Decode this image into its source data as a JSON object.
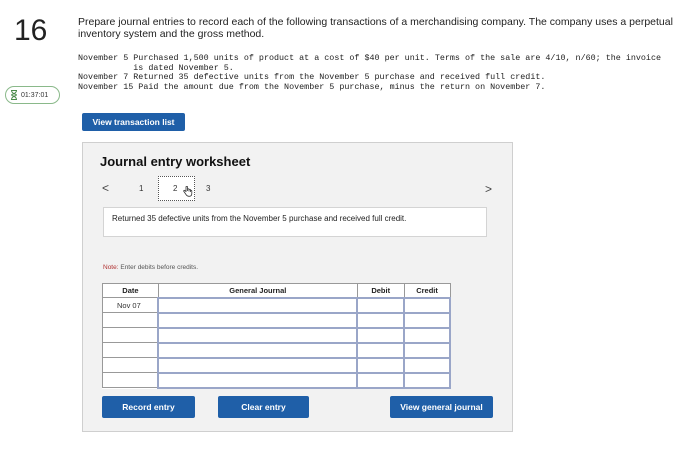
{
  "question": {
    "number": "16"
  },
  "timer": {
    "value": "01:37:01"
  },
  "prompt": "Prepare journal entries to record each of the following transactions of a merchandising company. The company uses a perpetual inventory system and the gross method.",
  "transactions": [
    "November 5 Purchased 1,500 units of product at a cost of $40 per unit. Terms of the sale are 4/10, n/60; the invoice",
    "           is dated November 5.",
    "November 7 Returned 35 defective units from the November 5 purchase and received full credit.",
    "November 15 Paid the amount due from the November 5 purchase, minus the return on November 7."
  ],
  "buttons": {
    "view_transaction_list": "View transaction list",
    "record_entry": "Record entry",
    "clear_entry": "Clear entry",
    "view_general_journal": "View general journal"
  },
  "worksheet": {
    "title": "Journal entry worksheet",
    "pages": [
      "1",
      "2",
      "3"
    ],
    "current_page": "2",
    "prev_glyph": "<",
    "next_glyph": ">",
    "description": "Returned 35 defective units from the November 5 purchase and received full credit.",
    "note_prefix": "Note:",
    "note_text": " Enter debits before credits."
  },
  "journal": {
    "headers": {
      "date": "Date",
      "general_journal": "General Journal",
      "debit": "Debit",
      "credit": "Credit"
    },
    "rows": [
      {
        "date": "Nov 07"
      },
      {
        "date": ""
      },
      {
        "date": ""
      },
      {
        "date": ""
      },
      {
        "date": ""
      },
      {
        "date": ""
      }
    ]
  },
  "colors": {
    "button_blue": "#1f5fa8",
    "worksheet_bg": "#f2f2f2",
    "timer_border": "#8ab98a"
  }
}
